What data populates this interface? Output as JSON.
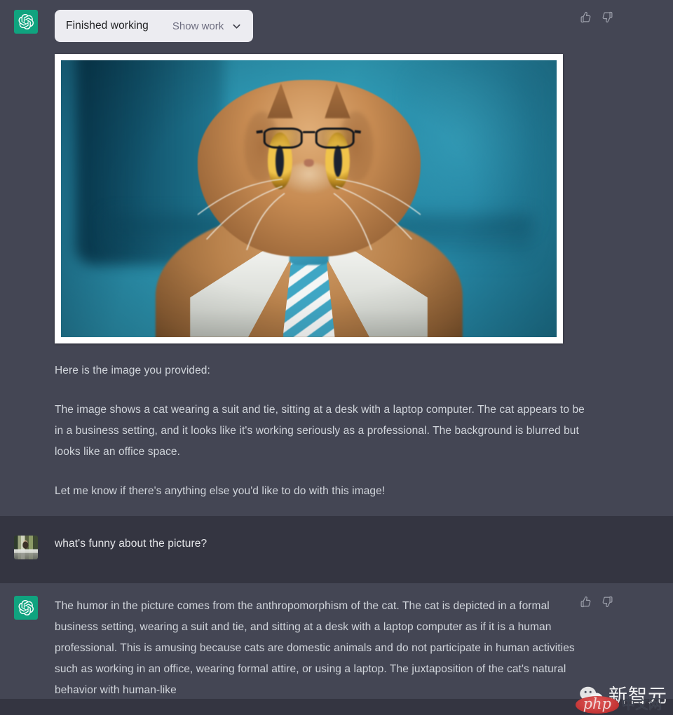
{
  "theme": {
    "bg_assistant": "#444654",
    "bg_user": "#343541",
    "text_primary": "#d1d5db",
    "accent_green": "#10a37f",
    "pill_bg": "#ececf1"
  },
  "messages": [
    {
      "role": "assistant",
      "avatar_name": "openai-logo-avatar",
      "tool_bar": {
        "status_label": "Finished working",
        "toggle_label": "Show work",
        "chevron": "chevron-down-icon"
      },
      "attachment": {
        "caption": "photo of an orange Persian cat wearing black glasses, a white collar shirt and a blue-and-white striped tie, against a blurred teal office background"
      },
      "paragraphs": [
        "Here is the image you provided:",
        "The image shows a cat wearing a suit and tie, sitting at a desk with a laptop computer. The cat appears to be in a business setting, and it looks like it's working seriously as a professional. The background is blurred but looks like an office space.",
        "Let me know if there's anything else you'd like to do with this image!"
      ],
      "feedback": {
        "thumbs_up": "thumbs-up-icon",
        "thumbs_down": "thumbs-down-icon"
      }
    },
    {
      "role": "user",
      "avatar_name": "user-photo-avatar",
      "text": "what's funny about the picture?"
    },
    {
      "role": "assistant",
      "avatar_name": "openai-logo-avatar",
      "paragraphs": [
        "The humor in the picture comes from the anthropomorphism of the cat. The cat is depicted in a formal business setting, wearing a suit and tie, and sitting at a desk with a laptop computer as if it is a human professional. This is amusing because cats are domestic animals and do not participate in human activities such as working in an office, wearing formal attire, or using a laptop. The juxtaposition of the cat's natural behavior with human-like"
      ],
      "feedback": {
        "thumbs_up": "thumbs-up-icon",
        "thumbs_down": "thumbs-down-icon"
      }
    }
  ],
  "watermarks": {
    "wechat_icon": "wechat-logo-icon",
    "wechat_text": "新智元",
    "php_badge": "php",
    "php_suffix": "中文网"
  }
}
